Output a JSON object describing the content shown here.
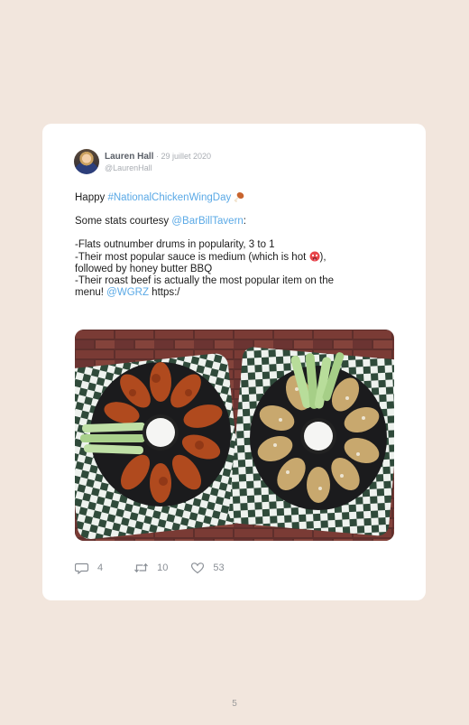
{
  "tweet": {
    "author_name": "Lauren Hall",
    "date": " · 29 juillet 2020",
    "handle": "@LaurenHall",
    "lines": {
      "l1_prefix": "Happy ",
      "l1_hashtag": "#NationalChickenWingDay",
      "l2_prefix": "Some stats courtesy ",
      "l2_mention": "@BarBillTavern",
      "l2_suffix": ":",
      "l3": "-Flats outnumber drums in popularity, 3 to 1",
      "l4_prefix": "-Their most popular sauce is medium (which is hot ",
      "l4_suffix": "),",
      "l5": "followed by honey butter BBQ",
      "l6": "-Their roast beef is actually the most popular item on the",
      "l7_prefix": "menu! ",
      "l7_mention": "@WGRZ",
      "l7_suffix": " https:/"
    },
    "stats": {
      "replies": "4",
      "retweets": "10",
      "likes": "53"
    }
  },
  "page": {
    "number": "5"
  },
  "colors": {
    "background": "#f2e6dd",
    "card": "#ffffff",
    "link": "#5aa9e6"
  },
  "icons": [
    "chicken-leg-icon",
    "hot-face-icon",
    "reply-icon",
    "retweet-icon",
    "heart-icon"
  ]
}
